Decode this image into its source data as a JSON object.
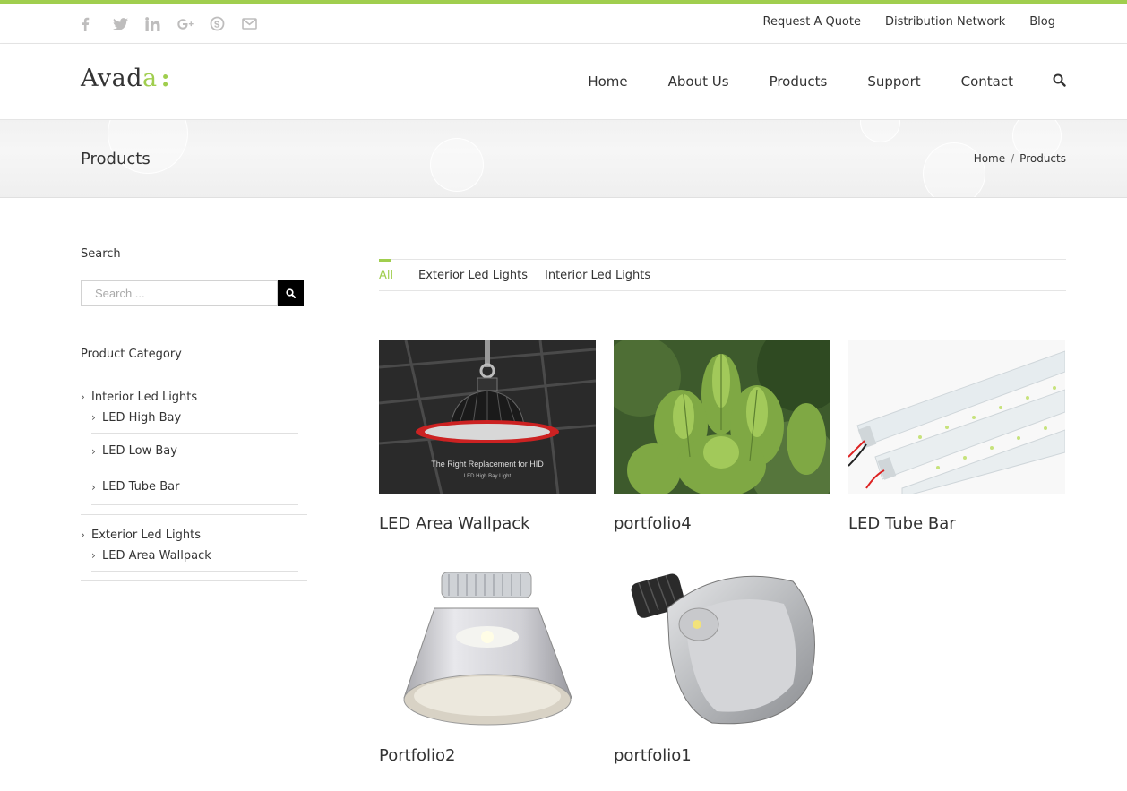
{
  "colors": {
    "accent": "#a0ce4e",
    "text": "#333333",
    "icon_gray": "#bebdbd"
  },
  "social_icons": [
    "facebook-icon",
    "twitter-icon",
    "linkedin-icon",
    "google-plus-icon",
    "skype-icon",
    "email-icon"
  ],
  "top_nav": [
    "Request A Quote",
    "Distribution Network",
    "Blog"
  ],
  "logo": {
    "text_start": "Avad",
    "text_accent": "a",
    "dots": ":"
  },
  "main_nav": [
    "Home",
    "About Us",
    "Products",
    "Support",
    "Contact"
  ],
  "page_title": "Products",
  "breadcrumb": {
    "home": "Home",
    "separator": "/",
    "current": "Products"
  },
  "sidebar": {
    "search_title": "Search",
    "search_placeholder": "Search ...",
    "category_title": "Product Category",
    "categories": [
      {
        "label": "Interior Led Lights",
        "children": [
          "LED High Bay",
          "LED Low Bay",
          "LED Tube Bar"
        ]
      },
      {
        "label": "Exterior Led Lights",
        "children": [
          "LED Area Wallpack"
        ]
      }
    ]
  },
  "filters": [
    "All",
    "Exterior Led Lights",
    "Interior Led Lights"
  ],
  "active_filter": "All",
  "portfolio": [
    {
      "title": "LED Area Wallpack",
      "image_caption": "The Right Replacement for HID",
      "image_subcaption": "LED High Bay Light"
    },
    {
      "title": "portfolio4"
    },
    {
      "title": "LED Tube Bar"
    },
    {
      "title": "Portfolio2"
    },
    {
      "title": "portfolio1"
    }
  ]
}
